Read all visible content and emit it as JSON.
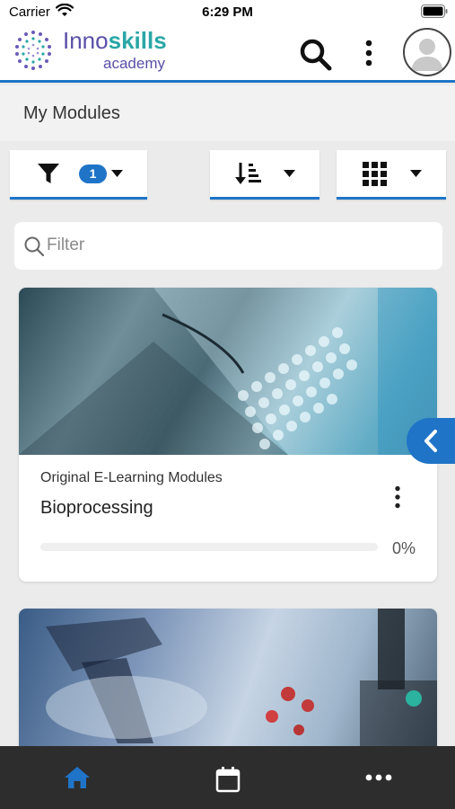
{
  "status_bar": {
    "carrier": "Carrier",
    "time": "6:29 PM"
  },
  "header": {
    "logo_word_1": "Inno",
    "logo_word_2": "skills",
    "logo_sub": "academy",
    "icons": [
      "search-icon",
      "more-vert-icon",
      "avatar-icon"
    ]
  },
  "page": {
    "title": "My Modules"
  },
  "toolbar": {
    "filter_count": "1",
    "icons": [
      "filter-icon",
      "sort-icon",
      "grid-view-icon",
      "caret-down-icon"
    ]
  },
  "search": {
    "placeholder": "Filter",
    "value": ""
  },
  "modules": [
    {
      "category": "Original E-Learning Modules",
      "title": "Bioprocessing",
      "progress_text": "0%",
      "progress": 0
    }
  ],
  "side_tab": {
    "icon": "chevron-left-icon"
  },
  "bottom_nav": {
    "items": [
      "home-icon",
      "calendar-icon",
      "more-horiz-icon"
    ],
    "active": "home-icon"
  },
  "colors": {
    "accent": "#1f74c8",
    "brand_purple": "#5a4fa8",
    "brand_teal": "#2aa6a6",
    "nav_bg": "#2d2d2d"
  }
}
